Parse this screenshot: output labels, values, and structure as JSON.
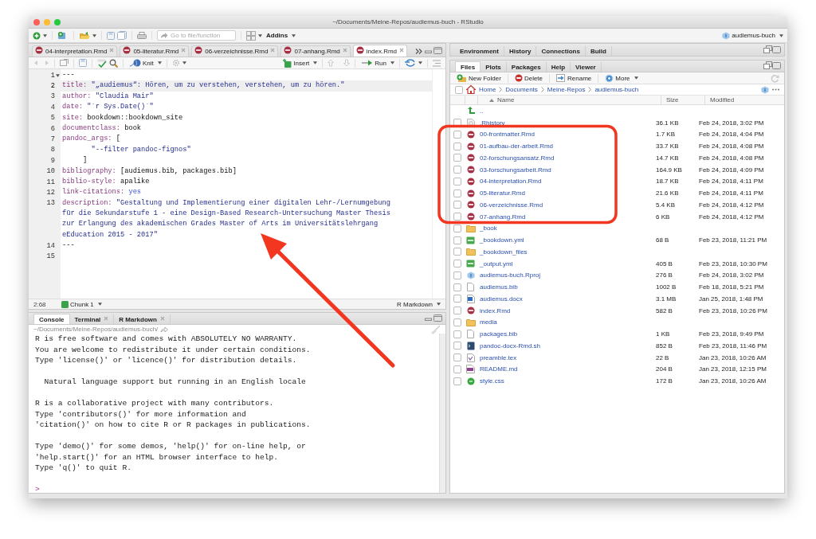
{
  "window": {
    "title": "~/Documents/Meine-Repos/audiemus-buch - RStudio"
  },
  "toolbar": {
    "goto": {
      "placeholder": "Go to file/function"
    },
    "addins": "Addins",
    "project": "audiemus-buch"
  },
  "editor": {
    "tabs": [
      {
        "label": "04-interpretation.Rmd",
        "selected": false
      },
      {
        "label": "05-literatur.Rmd",
        "selected": false
      },
      {
        "label": "06-verzeichnisse.Rmd",
        "selected": false
      },
      {
        "label": "07-anhang.Rmd",
        "selected": false
      },
      {
        "label": "index.Rmd",
        "selected": true
      }
    ],
    "buttons": {
      "knit": "Knit",
      "insert": "Insert",
      "run": "Run"
    },
    "lines": [
      {
        "number": "1",
        "fold": true,
        "current": false,
        "parts": [
          {
            "kind": "plain",
            "text": "---"
          }
        ]
      },
      {
        "number": "2",
        "fold": false,
        "current": true,
        "parts": [
          {
            "kind": "key",
            "text": "title:"
          },
          {
            "kind": "string",
            "text": " \"„audiemus“: Hören, um zu verstehen, verstehen, um zu hören.\""
          }
        ]
      },
      {
        "number": "3",
        "fold": false,
        "current": false,
        "parts": [
          {
            "kind": "key",
            "text": "author:"
          },
          {
            "kind": "string",
            "text": " \"Claudia Mair\""
          }
        ]
      },
      {
        "number": "4",
        "fold": false,
        "current": false,
        "parts": [
          {
            "kind": "key",
            "text": "date:"
          },
          {
            "kind": "string",
            "text": " \"`r Sys.Date()`\""
          }
        ]
      },
      {
        "number": "5",
        "fold": false,
        "current": false,
        "parts": [
          {
            "kind": "key",
            "text": "site:"
          },
          {
            "kind": "plain",
            "text": " bookdown::bookdown_site"
          }
        ]
      },
      {
        "number": "6",
        "fold": false,
        "current": false,
        "parts": [
          {
            "kind": "key",
            "text": "documentclass:"
          },
          {
            "kind": "plain",
            "text": " book"
          }
        ]
      },
      {
        "number": "7",
        "fold": false,
        "current": false,
        "parts": [
          {
            "kind": "key",
            "text": "pandoc_args:"
          },
          {
            "kind": "plain",
            "text": " ["
          }
        ]
      },
      {
        "number": "8",
        "fold": false,
        "current": false,
        "parts": [
          {
            "kind": "string",
            "text": "       \"--filter pandoc-fignos\""
          }
        ]
      },
      {
        "number": "9",
        "fold": false,
        "current": false,
        "parts": [
          {
            "kind": "plain",
            "text": "     ]"
          }
        ]
      },
      {
        "number": "10",
        "fold": false,
        "current": false,
        "parts": [
          {
            "kind": "key",
            "text": "bibliography:"
          },
          {
            "kind": "plain",
            "text": " [audiemus.bib, packages.bib]"
          }
        ]
      },
      {
        "number": "11",
        "fold": false,
        "current": false,
        "parts": [
          {
            "kind": "key",
            "text": "biblio-style:"
          },
          {
            "kind": "plain",
            "text": " apalike"
          }
        ]
      },
      {
        "number": "12",
        "fold": false,
        "current": false,
        "parts": [
          {
            "kind": "key",
            "text": "link-citations:"
          },
          {
            "kind": "keyword",
            "text": " yes"
          }
        ]
      },
      {
        "number": "13",
        "fold": false,
        "current": false,
        "parts": [
          {
            "kind": "key",
            "text": "description:"
          },
          {
            "kind": "string",
            "text": " \"Gestaltung und Implementierung einer digitalen Lehr-/Lernumgebung"
          }
        ]
      },
      {
        "fold": false,
        "current": false,
        "parts": [
          {
            "kind": "string",
            "text": "für die Sekundarstufe 1 - eine Design-Based Research-Untersuchung Master Thesis"
          }
        ]
      },
      {
        "fold": false,
        "current": false,
        "parts": [
          {
            "kind": "string",
            "text": "zur Erlangung des akademischen Grades Master of Arts im Universitätslehrgang"
          }
        ]
      },
      {
        "fold": false,
        "current": false,
        "parts": [
          {
            "kind": "string",
            "text": "eEducation 2015 - 2017\""
          }
        ]
      },
      {
        "number": "14",
        "fold": false,
        "current": false,
        "parts": [
          {
            "kind": "plain",
            "text": "---"
          }
        ]
      },
      {
        "number": "15",
        "fold": false,
        "current": false
      }
    ],
    "status": {
      "position": "2:68",
      "chunk": "Chunk 1",
      "mode": "R Markdown"
    }
  },
  "console": {
    "tabs": [
      {
        "label": "Console",
        "selected": true,
        "closable": false
      },
      {
        "label": "Terminal",
        "selected": false,
        "closable": true
      },
      {
        "label": "R Markdown",
        "selected": false,
        "closable": true
      }
    ],
    "path": "~/Documents/Meine-Repos/audiemus-buch/",
    "output": [
      [
        "R is free software and comes with ABSOLUTELY NO WARRANTY.",
        "You are welcome to redistribute it under certain conditions.",
        "Type 'license()' or 'licence()' for distribution details."
      ],
      [
        "  Natural language support but running in an English locale"
      ],
      [
        "R is a collaborative project with many contributors.",
        "Type 'contributors()' for more information and",
        "'citation()' on how to cite R or R packages in publications."
      ],
      [
        "Type 'demo()' for some demos, 'help()' for on-line help, or",
        "'help.start()' for an HTML browser interface to help.",
        "Type 'q()' to quit R."
      ]
    ],
    "prompt": ">"
  },
  "environment_pane": {
    "tabs": [
      {
        "label": "Environment",
        "selected": false
      },
      {
        "label": "History",
        "selected": false
      },
      {
        "label": "Connections",
        "selected": false
      },
      {
        "label": "Build",
        "selected": false
      }
    ]
  },
  "files_pane": {
    "tabs": [
      {
        "label": "Files",
        "selected": true
      },
      {
        "label": "Plots",
        "selected": false
      },
      {
        "label": "Packages",
        "selected": false
      },
      {
        "label": "Help",
        "selected": false
      },
      {
        "label": "Viewer",
        "selected": false
      }
    ],
    "actions": [
      {
        "kind": "new-folder",
        "label": "New Folder"
      },
      {
        "kind": "delete",
        "label": "Delete"
      },
      {
        "kind": "rename",
        "label": "Rename"
      },
      {
        "kind": "more",
        "label": "More"
      }
    ],
    "select_all": {
      "checked": false
    },
    "breadcrumb": [
      "Home",
      "Documents",
      "Meine-Repos",
      "audiemus-buch"
    ],
    "columns": [
      "Name",
      "Size",
      "Modified"
    ],
    "rows": [
      {
        "kind": "up",
        "name": ".."
      },
      {
        "kind": "history",
        "name": ".Rhistory",
        "size": "36.1 KB",
        "modified": "Feb 24, 2018, 3:02 PM",
        "checked": false
      },
      {
        "kind": "rmd",
        "name": "00-frontmatter.Rmd",
        "size": "1.7 KB",
        "modified": "Feb 24, 2018, 4:04 PM",
        "checked": false
      },
      {
        "kind": "rmd",
        "name": "01-aufbau-der-arbeit.Rmd",
        "size": "33.7 KB",
        "modified": "Feb 24, 2018, 4:08 PM",
        "checked": false
      },
      {
        "kind": "rmd",
        "name": "02-forschungsansatz.Rmd",
        "size": "14.7 KB",
        "modified": "Feb 24, 2018, 4:08 PM",
        "checked": false
      },
      {
        "kind": "rmd",
        "name": "03-forschungsarbeit.Rmd",
        "size": "164.9 KB",
        "modified": "Feb 24, 2018, 4:09 PM",
        "checked": false
      },
      {
        "kind": "rmd",
        "name": "04-interpretation.Rmd",
        "size": "18.7 KB",
        "modified": "Feb 24, 2018, 4:11 PM",
        "checked": false
      },
      {
        "kind": "rmd",
        "name": "05-literatur.Rmd",
        "size": "21.6 KB",
        "modified": "Feb 24, 2018, 4:11 PM",
        "checked": false
      },
      {
        "kind": "rmd",
        "name": "06-verzeichnisse.Rmd",
        "size": "5.4 KB",
        "modified": "Feb 24, 2018, 4:12 PM",
        "checked": false
      },
      {
        "kind": "rmd",
        "name": "07-anhang.Rmd",
        "size": "6 KB",
        "modified": "Feb 24, 2018, 4:12 PM",
        "checked": false
      },
      {
        "kind": "folder",
        "name": "_book",
        "checked": false
      },
      {
        "kind": "yml",
        "name": "_bookdown.yml",
        "size": "68 B",
        "modified": "Feb 23, 2018, 11:21 PM",
        "checked": false
      },
      {
        "kind": "folder",
        "name": "_bookdown_files",
        "checked": false
      },
      {
        "kind": "yml",
        "name": "_output.yml",
        "size": "405 B",
        "modified": "Feb 23, 2018, 10:30 PM",
        "checked": false
      },
      {
        "kind": "rproj",
        "name": "audiemus-buch.Rproj",
        "size": "276 B",
        "modified": "Feb 24, 2018, 3:02 PM",
        "checked": false
      },
      {
        "kind": "text",
        "name": "audiemus.bib",
        "size": "1002 B",
        "modified": "Feb 18, 2018, 5:21 PM",
        "checked": false
      },
      {
        "kind": "docx",
        "name": "audiemus.docx",
        "size": "3.1 MB",
        "modified": "Jan 25, 2018, 1:48 PM",
        "checked": false
      },
      {
        "kind": "rmd",
        "name": "index.Rmd",
        "size": "582 B",
        "modified": "Feb 23, 2018, 10:26 PM",
        "checked": false
      },
      {
        "kind": "folder",
        "name": "media",
        "checked": false
      },
      {
        "kind": "text",
        "name": "packages.bib",
        "size": "1 KB",
        "modified": "Feb 23, 2018, 9:49 PM",
        "checked": false
      },
      {
        "kind": "shell",
        "name": "pandoc-docx-Rmd.sh",
        "size": "852 B",
        "modified": "Feb 23, 2018, 11:46 PM",
        "checked": false
      },
      {
        "kind": "tex",
        "name": "preamble.tex",
        "size": "22 B",
        "modified": "Jan 23, 2018, 10:26 AM",
        "checked": false
      },
      {
        "kind": "markdown",
        "name": "README.md",
        "size": "204 B",
        "modified": "Jan 23, 2018, 12:15 PM",
        "checked": false
      },
      {
        "kind": "css",
        "name": "style.css",
        "size": "172 B",
        "modified": "Jan 23, 2018, 10:26 AM",
        "checked": false
      }
    ]
  },
  "annotations": {
    "highlight_box": true,
    "arrow": true
  }
}
